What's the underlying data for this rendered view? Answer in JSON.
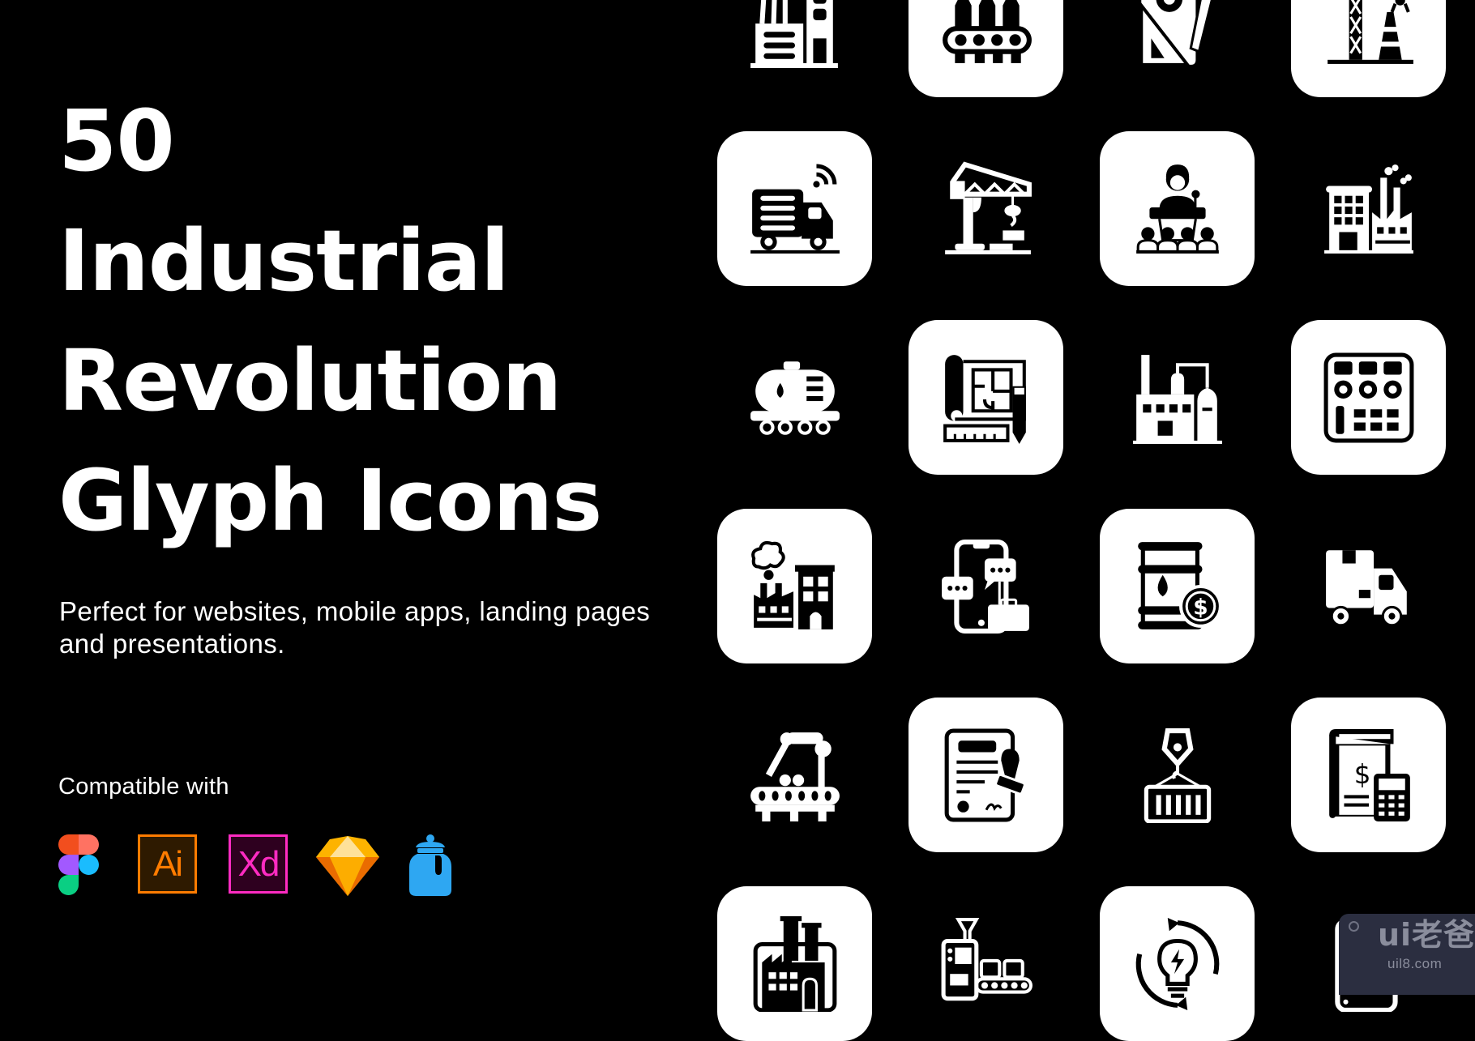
{
  "hero": {
    "title_lines": [
      "50",
      "Industrial",
      "Revolution",
      "Glyph Icons"
    ],
    "subtitle": "Perfect for websites, mobile apps, landing pages and presentations.",
    "compatible_label": "Compatible with"
  },
  "compatible_apps": [
    {
      "name": "Figma",
      "icon": "figma-logo"
    },
    {
      "name": "Adobe Illustrator",
      "icon": "illustrator-logo",
      "label": "Ai",
      "color": "#ff7c00",
      "bg": "#2e1a00"
    },
    {
      "name": "Adobe XD",
      "icon": "xd-logo",
      "label": "Xd",
      "color": "#ff2bc2",
      "bg": "#2e001f"
    },
    {
      "name": "Sketch",
      "icon": "sketch-logo"
    },
    {
      "name": "IconJar",
      "icon": "iconjar-logo",
      "color": "#2ea7f2"
    }
  ],
  "icon_grid": {
    "columns": 4,
    "rows": [
      [
        "factory-building",
        "bottling-conveyor",
        "design-tools",
        "construction-crane-cone"
      ],
      [
        "smart-delivery-truck",
        "tower-crane",
        "speaker-podium",
        "industrial-building"
      ],
      [
        "oil-tank-wagon",
        "blueprint",
        "chemical-plant",
        "control-panel"
      ],
      [
        "factory-pollution",
        "mobile-business-chat",
        "oil-barrel-price",
        "delivery-van"
      ],
      [
        "robotic-arm-conveyor",
        "certificate-stamp",
        "crane-container",
        "finance-book-calculator"
      ],
      [
        "factory",
        "production-line",
        "idea-energy-cycle",
        "mobile-device"
      ]
    ],
    "filled_pattern": [
      [
        false,
        true,
        false,
        true
      ],
      [
        true,
        false,
        true,
        false
      ],
      [
        false,
        true,
        false,
        true
      ],
      [
        true,
        false,
        true,
        false
      ],
      [
        false,
        true,
        false,
        true
      ],
      [
        true,
        false,
        true,
        false
      ]
    ]
  },
  "watermark": {
    "brand": "ui老爸",
    "url": "uil8.com"
  },
  "colors": {
    "background": "#000000",
    "foreground": "#ffffff",
    "watermark_bg": "#2b2e40",
    "watermark_text": "#8a8d9c"
  }
}
